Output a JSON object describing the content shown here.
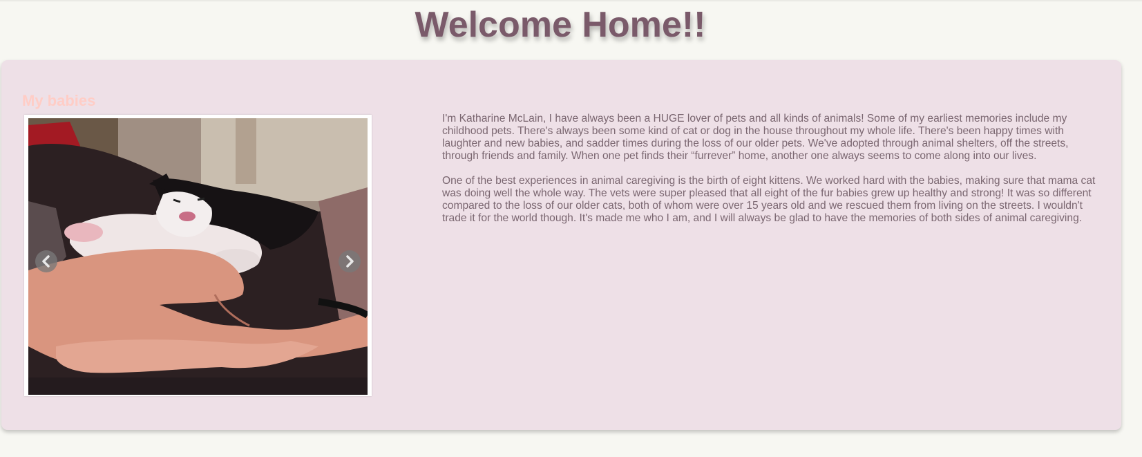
{
  "page": {
    "title": "Welcome Home!!"
  },
  "gallery": {
    "heading": "My babies",
    "image_alt": "Black and white kitten held in hands",
    "prev_icon": "chevron-left-icon",
    "next_icon": "chevron-right-icon"
  },
  "bio": {
    "paragraph_1": "I'm Katharine McLain, I have always been a HUGE lover of pets and all kinds of animals! Some of my earliest memories include my childhood pets. There's always been some kind of cat or dog in the house throughout my whole life. There's been happy times with laughter and new babies, and sadder times during the loss of our older pets. We've adopted through animal shelters, off the streets, through friends and family. When one pet finds their “furrever” home, another one always seems to come along into our lives.",
    "paragraph_2": "One of the best experiences in animal caregiving is the birth of eight kittens. We worked hard with the babies, making sure that mama cat was doing well the whole way. The vets were super pleased that all eight of the fur babies grew up healthy and strong! It was so different compared to the loss of our older cats, both of whom were over 15 years old and we rescued them from living on the streets. I wouldn't trade it for the world though. It's made me who I am, and I will always be glad to have the memories of both sides of animal caregiving."
  },
  "colors": {
    "background": "#f7f7f2",
    "card": "#eee0e7",
    "title": "#7a5a6a",
    "heading": "#ffcdc6",
    "body_text": "#7a6670"
  }
}
